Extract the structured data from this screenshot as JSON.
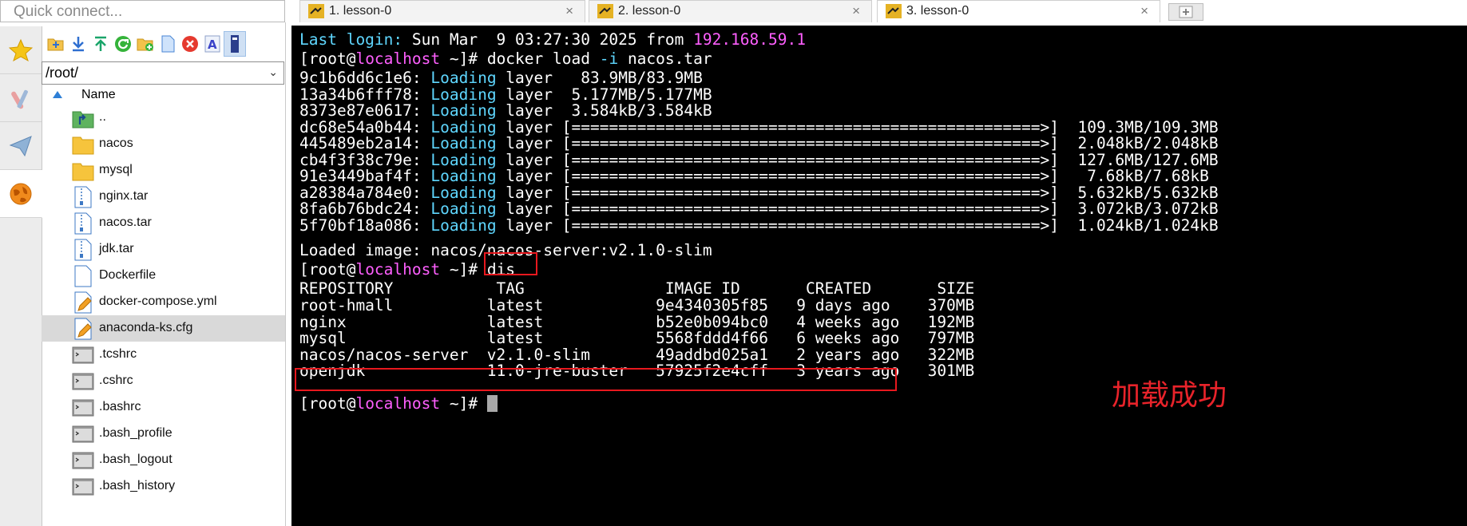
{
  "sidebar": {
    "quick_connect_placeholder": "Quick connect...",
    "rail_tabs": [
      "favorites-star",
      "tools",
      "send-files",
      "sftp-browser"
    ],
    "toolbar_icons": [
      "open-folder-icon",
      "download-icon",
      "upload-icon",
      "refresh-icon",
      "new-folder-icon",
      "new-file-icon",
      "delete-icon",
      "rename-icon",
      "view-icon"
    ],
    "path": "/root/",
    "column_name": "Name",
    "files": [
      {
        "name": "..",
        "type": "parent"
      },
      {
        "name": "nacos",
        "type": "folder"
      },
      {
        "name": "mysql",
        "type": "folder"
      },
      {
        "name": "nginx.tar",
        "type": "archive"
      },
      {
        "name": "nacos.tar",
        "type": "archive"
      },
      {
        "name": "jdk.tar",
        "type": "archive"
      },
      {
        "name": "Dockerfile",
        "type": "file"
      },
      {
        "name": "docker-compose.yml",
        "type": "edit"
      },
      {
        "name": "anaconda-ks.cfg",
        "type": "edit"
      },
      {
        "name": ".tcshrc",
        "type": "shell"
      },
      {
        "name": ".cshrc",
        "type": "shell"
      },
      {
        "name": ".bashrc",
        "type": "shell"
      },
      {
        "name": ".bash_profile",
        "type": "shell"
      },
      {
        "name": ".bash_logout",
        "type": "shell"
      },
      {
        "name": ".bash_history",
        "type": "shell"
      }
    ],
    "selected_file": "anaconda-ks.cfg"
  },
  "tabs": [
    {
      "label": "1. lesson-0",
      "active": false
    },
    {
      "label": "2. lesson-0",
      "active": false
    },
    {
      "label": "3. lesson-0",
      "active": true
    }
  ],
  "tab_close_glyph": "×",
  "terminal": {
    "login": {
      "prefix": "Last login:",
      "text": " Sun Mar  9 03:27:30 2025 from ",
      "ip": "192.168.59.1"
    },
    "prompt": {
      "open": "[root@",
      "host": "localhost",
      "close": " ~]# "
    },
    "cmd_load": "docker load ",
    "cmd_flag": "-i",
    "cmd_arg": " nacos.tar",
    "loading_word": "Loading",
    "layers": [
      {
        "id": "9c1b6dd6c1e6",
        "bar": "",
        "size": "  83.9MB/83.9MB"
      },
      {
        "id": "13a34b6fff78",
        "bar": "",
        "size": " 5.177MB/5.177MB"
      },
      {
        "id": "8373e87e0617",
        "bar": "",
        "size": " 3.584kB/3.584kB"
      },
      {
        "id": "dc68e54a0b44",
        "bar": "[==================================================>]",
        "size": "  109.3MB/109.3MB"
      },
      {
        "id": "445489eb2a14",
        "bar": "[==================================================>]",
        "size": "  2.048kB/2.048kB"
      },
      {
        "id": "cb4f3f38c79e",
        "bar": "[==================================================>]",
        "size": "  127.6MB/127.6MB"
      },
      {
        "id": "91e3449baf4f",
        "bar": "[==================================================>]",
        "size": "   7.68kB/7.68kB"
      },
      {
        "id": "a28384a784e0",
        "bar": "[==================================================>]",
        "size": "  5.632kB/5.632kB"
      },
      {
        "id": "8fa6b76bdc24",
        "bar": "[==================================================>]",
        "size": "  3.072kB/3.072kB"
      },
      {
        "id": "5f70bf18a086",
        "bar": "[==================================================>]",
        "size": "  1.024kB/1.024kB"
      }
    ],
    "loaded_line": "Loaded image: nacos/nacos-server:v2.1.0-slim",
    "cmd_dis": "dis",
    "images_header": "REPOSITORY           TAG               IMAGE ID       CREATED       SIZE",
    "images": [
      "root-hmall          latest            9e4340305f85   9 days ago    370MB",
      "nginx               latest            b52e0b094bc0   4 weeks ago   192MB",
      "mysql               latest            5568fddd4f66   6 weeks ago   797MB",
      "nacos/nacos-server  v2.1.0-slim       49addbd025a1   2 years ago   322MB",
      "openjdk             11.0-jre-buster   57925f2e4cff   3 years ago   301MB"
    ],
    "highlighted_row": 3
  },
  "annotation": "加载成功",
  "colors": {
    "cyan": "#5fd7ff",
    "magenta": "#ff5fff",
    "highlight_red": "#e8181e"
  }
}
